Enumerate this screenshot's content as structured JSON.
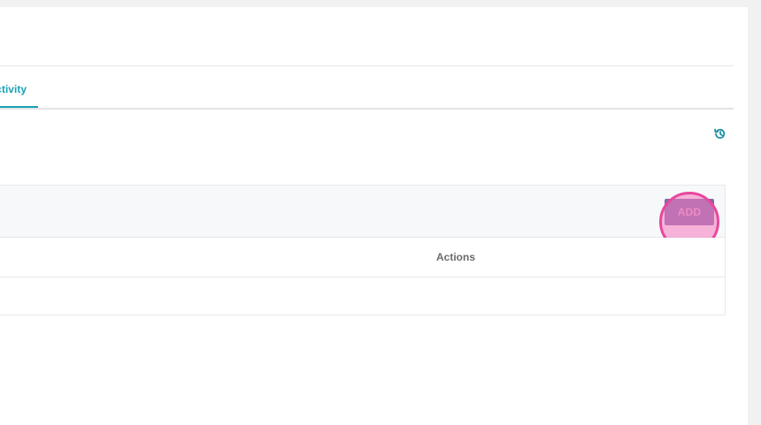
{
  "tabs": {
    "active_label": "Activity"
  },
  "toolbar": {
    "history_icon": "history-icon",
    "add_label": "ADD"
  },
  "table": {
    "columns": [
      "Actions"
    ]
  },
  "colors": {
    "accent": "#1aa2b7",
    "add_button_bg": "#7e6aa8",
    "highlight": "#e8479d"
  }
}
